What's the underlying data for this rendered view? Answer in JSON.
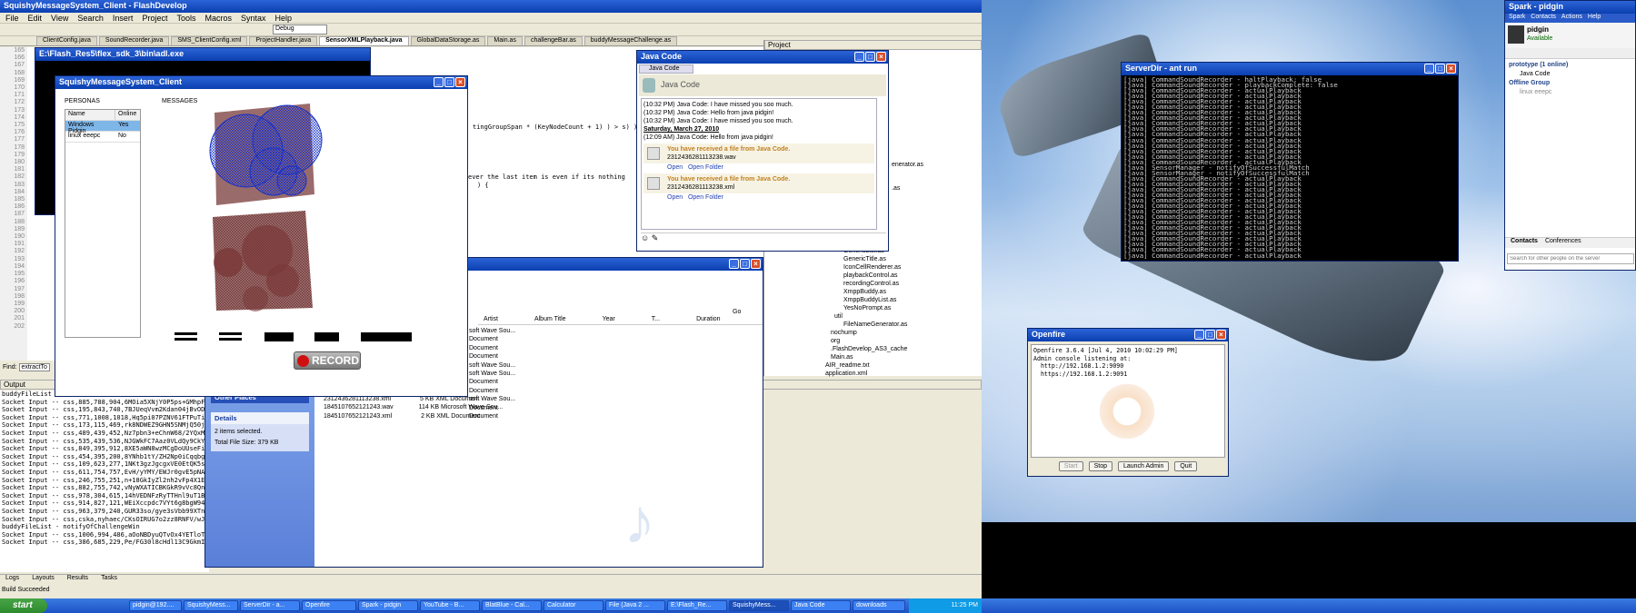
{
  "ide": {
    "title": "SquishyMessageSystem_Client - FlashDevelop",
    "menu": [
      "File",
      "Edit",
      "View",
      "Search",
      "Insert",
      "Project",
      "Tools",
      "Macros",
      "Syntax",
      "Help"
    ],
    "config": "Debug",
    "tabs": [
      "ClientConfig.java",
      "SoundRecorder.java",
      "SMS_ClientConfig.xml",
      "ProjectHandler.java",
      "SensorXMLPlayback.java",
      "GlobalDataStorage.as",
      "Main.as",
      "challengeBar.as",
      "buddyMessageChallenge.as"
    ],
    "active_tab": "SensorXMLPlayback.java",
    "project_label": "Project",
    "line_numbers": [
      "165",
      "166",
      "167",
      "168",
      "169",
      "170",
      "171",
      "172",
      "173",
      "174",
      "175",
      "176",
      "177",
      "178",
      "179",
      "180",
      "181",
      "182",
      "183",
      "184",
      "185",
      "186",
      "187",
      "188",
      "189",
      "190",
      "191",
      "192",
      "193",
      "194",
      "195",
      "196",
      "197",
      "198",
      "199",
      "200",
      "201",
      "202"
    ],
    "code_line1": "tingGroupSpan * (KeyNodeCount + 1) ) > s) ) {",
    "code_line2": "ever the last item is even if its nothing",
    "code_line3": ") {",
    "find_label": "Find:",
    "find_value": "extractTo",
    "output_label": "Output",
    "output_lines": [
      "buddyFileList - cs,1006,268,181,x4YxWUti8hnPsKTzc6uG1lnBx",
      "Socket Input -- css,885,788,904,6MOia5XNjY0P5ps+GMhpF0IrJ",
      "Socket Input -- css,195,843,740,7BJUeqVvm2Kdan04jBvODIN6P",
      "Socket Input -- css,771,1008,1018,Hq5pi07PZNV61FTPuTiK2Ghl",
      "Socket Input -- css,173,115,469,rk8NDWEZ9GHN5SNMjQ50jR1bU",
      "Socket Input -- css,489,439,452,Nz7pbn3+eChnW68/2YQxMeTvS",
      "Socket Input -- css,535,439,536,NJGWkFC7Aaz0VLdQy9CkYxkbR",
      "Socket Input -- css,849,395,912,8XE5aWN8wzMCgDoUUseFiQcnK",
      "Socket Input -- css,454,395,200,8YNhb1tY/ZH2Np0iCqqbgNXe1",
      "Socket Input -- css,109,623,277,1NKt3gzJgcgxVE0EtQK5sxU8e",
      "Socket Input -- css,611,754,757,EvH/yYMY/EWJr0gvE5pNAakXX",
      "Socket Input -- css,246,755,251,n+18GkIyZl2nh2vFp4X1E9DlL",
      "Socket Input -- css,882,755,742,vNyWXATICBKGkR9vVc8QnlAk6",
      "Socket Input -- css,978,304,615,14hVEDNFzRyTTHnl9uT1BB7pE",
      "Socket Input -- css,914,827,121,WEiXccpdc7VYt6g8bgW94ARw0",
      "Socket Input -- css,963,379,240,GUR33so/gye3sVbb99XTnr3fD",
      "Socket Input -- css,cska,nyhaec/CKsOIRUG7o2zz8RNFV/wJAaDQ4Ya5",
      "buddyFileList - notifyOfChallengeWin",
      "Socket Input -- css,1006,994,486,aOoNBDyuQTvOx4YETloTiyaNP",
      "Socket Input -- css,386,685,229,Pe/FG30l8cHdl13C9GkmID13F"
    ],
    "bottom_tabs": [
      "Logs",
      "Layouts",
      "Results",
      "Tasks"
    ],
    "status": "Build Succeeded",
    "project_files": [
      "GenericList.as",
      "GenericTitle.as",
      "IconCellRenderer.as",
      "playbackControl.as",
      "recordingControl.as",
      "XmppBuddy.as",
      "XmppBuddyList.as",
      "YesNoPrompt.as",
      "util",
      "FileNameGenerator.as",
      "nochump",
      "org",
      ".FlashDevelop_AS3_cache",
      "Main.as",
      "AIR_readme.txt",
      "application.xml"
    ],
    "partial_file1": "enerator.as",
    "partial_file2": ".as"
  },
  "flex_console": {
    "title": "E:\\Flash_Res5\\flex_sdk_3\\bin\\adl.exe"
  },
  "squishy": {
    "title": "SquishyMessageSystem_Client",
    "personas_label": "PERSONAS",
    "messages_label": "MESSAGES",
    "col_name": "Name",
    "col_online": "Online",
    "rows": [
      {
        "name": "Windows Pidgin",
        "online": "Yes"
      },
      {
        "name": "linux eeepc",
        "online": "No"
      }
    ],
    "record_label": "RECORD"
  },
  "explorer": {
    "go_label": "Go",
    "columns": [
      "Artist",
      "Album Title",
      "Year",
      "T...",
      "Duration"
    ],
    "types": [
      "soft Wave Sou...",
      "Document",
      "Document",
      "Document",
      "soft Wave Sou...",
      "soft Wave Sou...",
      "Document",
      "Document",
      "soft Wave Sou...",
      "Document",
      "Document"
    ],
    "files": [
      {
        "name": "2312436281113238.xml",
        "size": "5 KB",
        "type": "XML Document"
      },
      {
        "name": "1845107652121243.wav",
        "size": "114 KB",
        "type": "Microsoft Wave Sou..."
      },
      {
        "name": "1845107652121243.xml",
        "size": "2 KB",
        "type": "XML Document"
      }
    ],
    "other_places": "Other Places",
    "details": "Details",
    "items_selected": "2 items selected.",
    "total_size": "Total File Size: 379 KB"
  },
  "pidgin_chat": {
    "title": "Java Code",
    "tab": "Java Code",
    "header_name": "Java Code",
    "messages": [
      "(10:32 PM) Java Code: I have missed you soo much.",
      "(10:32 PM) Java Code: Hello from java pidgin!",
      "(10:32 PM) Java Code: I have missed you soo much."
    ],
    "date": "Saturday, March 27, 2010",
    "msg_after_date": "(12:09 AM) Java Code: Hello from java pidgin!",
    "file1_notice": "You have received a file from Java Code.",
    "file1_name": "2312436281113238.wav",
    "file2_notice": "You have received a file from Java Code.",
    "file2_name": "2312436281113238.xml",
    "open": "Open",
    "open_folder": "Open Folder"
  },
  "ant_console": {
    "title": "ServerDir - ant run",
    "lines": [
      "[java] CommandSoundRecorder - haltPlayback: false",
      "[java] CommandSoundRecorder - playbackComplete: false",
      "[java] CommandSoundRecorder - actualPlayback",
      "[java] CommandSoundRecorder - actualPlayback",
      "[java] CommandSoundRecorder - actualPlayback",
      "[java] CommandSoundRecorder - actualPlayback",
      "[java] CommandSoundRecorder - actualPlayback",
      "[java] CommandSoundRecorder - actualPlayback",
      "[java] CommandSoundRecorder - actualPlayback",
      "[java] CommandSoundRecorder - actualPlayback",
      "[java] CommandSoundRecorder - actualPlayback",
      "[java] CommandSoundRecorder - actualPlayback",
      "[java] CommandSoundRecorder - actualPlayback",
      "[java] CommandSoundRecorder - actualPlayback",
      "[java] CommandSoundRecorder - actualPlayback",
      "[java] CommandSoundRecorder - actualPlayback",
      "[java] SensorManager - notifyOfSuccessfulMatch",
      "[java] SensorManager - notifyOfSuccessfulMatch",
      "[java] CommandSoundRecorder - actualPlayback",
      "[java] CommandSoundRecorder - actualPlayback",
      "[java] CommandSoundRecorder - actualPlayback",
      "[java] CommandSoundRecorder - actualPlayback",
      "[java] CommandSoundRecorder - actualPlayback",
      "[java] CommandSoundRecorder - actualPlayback",
      "[java] CommandSoundRecorder - actualPlayback",
      "[java] CommandSoundRecorder - actualPlayback",
      "[java] CommandSoundRecorder - actualPlayback",
      "[java] CommandSoundRecorder - actualPlayback",
      "[java] CommandSoundRecorder - actualPlayback",
      "[java] CommandSoundRecorder - actualPlayback",
      "[java] CommandSoundRecorder - actualPlayback",
      "[java] CommandSoundRecorder - actualPlayback",
      "[java] CommandSoundRecorder - actualPlayback"
    ]
  },
  "spark": {
    "title": "Spark - pidgin",
    "menu": [
      "Spark",
      "Contacts",
      "Actions",
      "Help"
    ],
    "user": "pidgin",
    "status": "Available",
    "group1": "prototype (1 online)",
    "contact1": "Java Code",
    "group2": "Offline Group",
    "contact2": "linux eeepc",
    "tab_contacts": "Contacts",
    "tab_conferences": "Conferences",
    "search_placeholder": "Search for other people on the server"
  },
  "openfire": {
    "title": "Openfire",
    "line1": "Openfire 3.6.4 [Jul 4, 2010 10:02:29 PM]",
    "line2": "Admin console listening at:",
    "line3": "  http://192.168.1.2:9090",
    "line4": "  https://192.168.1.2:9091",
    "buttons": [
      "Start",
      "Stop",
      "Launch Admin",
      "Quit"
    ]
  },
  "taskbar": {
    "start": "start",
    "items": [
      "pidgin@192....",
      "SquishyMess...",
      "ServerDir - a...",
      "Openfire",
      "Spark - pidgin",
      "YouTube - B...",
      "BlatBlue - Cal...",
      "Calculator",
      "File (Java 2 ...",
      "E:\\Flash_Re...",
      "SquishyMess...",
      "Java Code",
      "downloads"
    ],
    "clock": "11:25 PM"
  },
  "colors": {
    "title_bar": "#0b3fb0",
    "record_red": "#d01010",
    "blob_blue": "#1530c8",
    "blob_brown": "#8a4a4a"
  }
}
